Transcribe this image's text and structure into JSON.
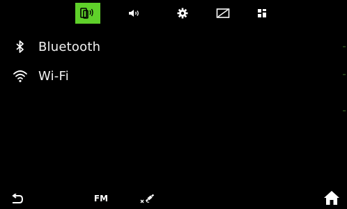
{
  "tabs": [
    {
      "id": "connections",
      "icon": "phone-connection-icon",
      "active": true
    },
    {
      "id": "sound",
      "icon": "speaker-icon",
      "active": false
    },
    {
      "id": "settings",
      "icon": "gear-icon",
      "active": false
    },
    {
      "id": "display",
      "icon": "display-icon",
      "active": false
    },
    {
      "id": "apps",
      "icon": "apps-grid-icon",
      "active": false
    }
  ],
  "menu": {
    "items": [
      {
        "label": "Bluetooth",
        "icon": "bluetooth-icon"
      },
      {
        "label": "Wi-Fi",
        "icon": "wifi-icon"
      }
    ]
  },
  "bottom": {
    "back_icon": "back-arrow-icon",
    "fm_label": "FM",
    "nav_icon": "navigation-satellite-icon",
    "home_icon": "home-icon"
  },
  "colors": {
    "background": "#000000",
    "accent": "#5fd02a",
    "text": "#ffffff"
  }
}
